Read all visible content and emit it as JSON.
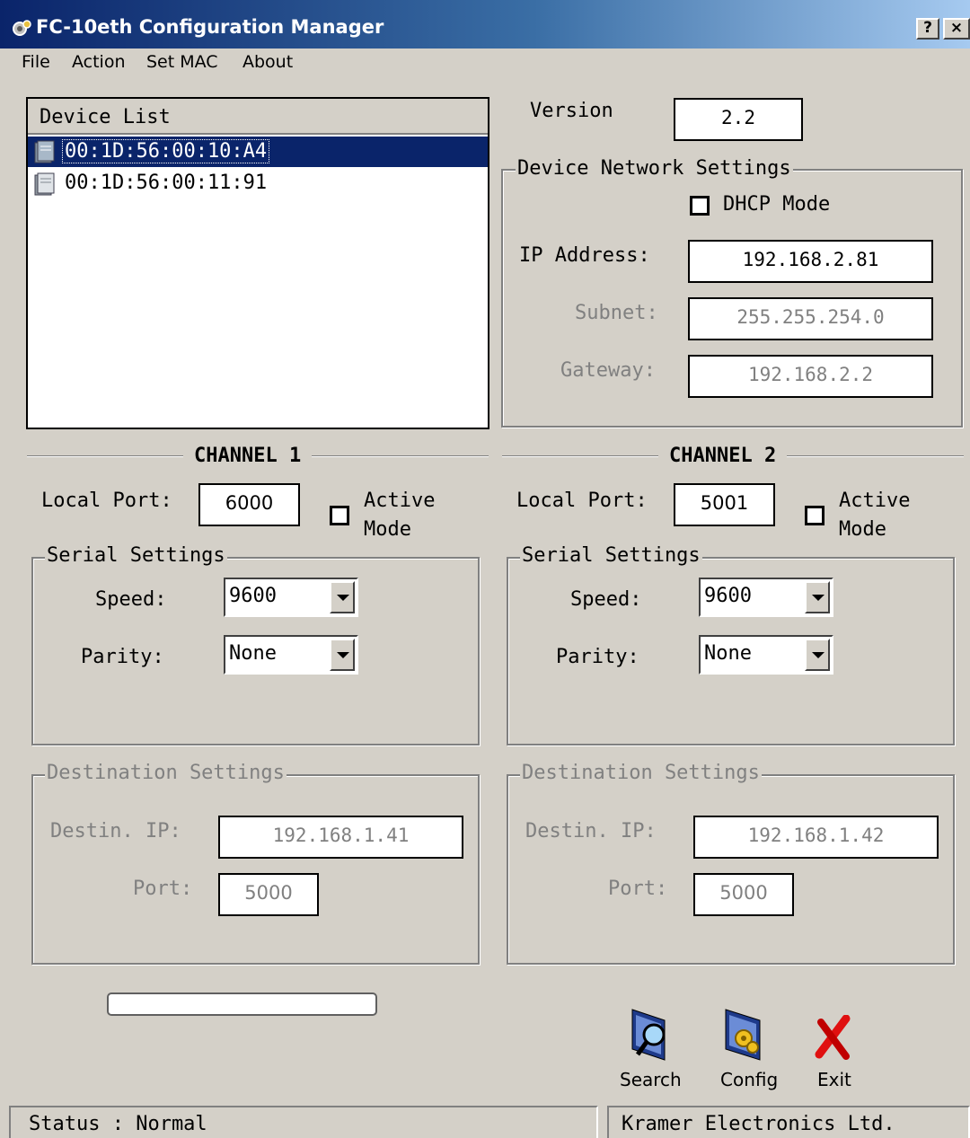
{
  "window": {
    "title": "FC-10eth Configuration Manager",
    "help_button": "?",
    "close_button": "×"
  },
  "menu": [
    "File",
    "Action",
    "Set MAC",
    "About"
  ],
  "device_list": {
    "header": "Device List",
    "items": [
      "00:1D:56:00:10:A4",
      "00:1D:56:00:11:91"
    ],
    "selected_index": 0
  },
  "version": {
    "label": "Version",
    "value": "2.2"
  },
  "network": {
    "title": "Device Network Settings",
    "dhcp_label": "DHCP Mode",
    "dhcp_checked": false,
    "ip_label": "IP Address:",
    "ip_value": "192.168.2.81",
    "subnet_label": "Subnet:",
    "subnet_value": "255.255.254.0",
    "gateway_label": "Gateway:",
    "gateway_value": "192.168.2.2"
  },
  "channels": [
    {
      "title": "CHANNEL 1",
      "local_port_label": "Local Port:",
      "local_port": "6000",
      "active_mode_label_1": "Active",
      "active_mode_label_2": "Mode",
      "active_mode_checked": false,
      "serial_title": "Serial Settings",
      "speed_label": "Speed:",
      "speed": "9600",
      "parity_label": "Parity:",
      "parity": "None",
      "dest_title": "Destination Settings",
      "dest_ip_label": "Destin. IP:",
      "dest_ip": "192.168.1.41",
      "dest_port_label": "Port:",
      "dest_port": "5000"
    },
    {
      "title": "CHANNEL 2",
      "local_port_label": "Local Port:",
      "local_port": "5001",
      "active_mode_label_1": "Active",
      "active_mode_label_2": "Mode",
      "active_mode_checked": false,
      "serial_title": "Serial Settings",
      "speed_label": "Speed:",
      "speed": "9600",
      "parity_label": "Parity:",
      "parity": "None",
      "dest_title": "Destination Settings",
      "dest_ip_label": "Destin. IP:",
      "dest_ip": "192.168.1.42",
      "dest_port_label": "Port:",
      "dest_port": "5000"
    }
  ],
  "progress": 0,
  "toolbar": {
    "search_label": "Search",
    "config_label": "Config",
    "exit_label": "Exit"
  },
  "status": {
    "left": "Status : Normal",
    "right": "Kramer Electronics Ltd."
  },
  "colors": {
    "titlebar_start": "#0a246a",
    "titlebar_end": "#a6caf0",
    "selection": "#0a246a",
    "face": "#d4d0c8",
    "exit_red": "#e01010"
  }
}
